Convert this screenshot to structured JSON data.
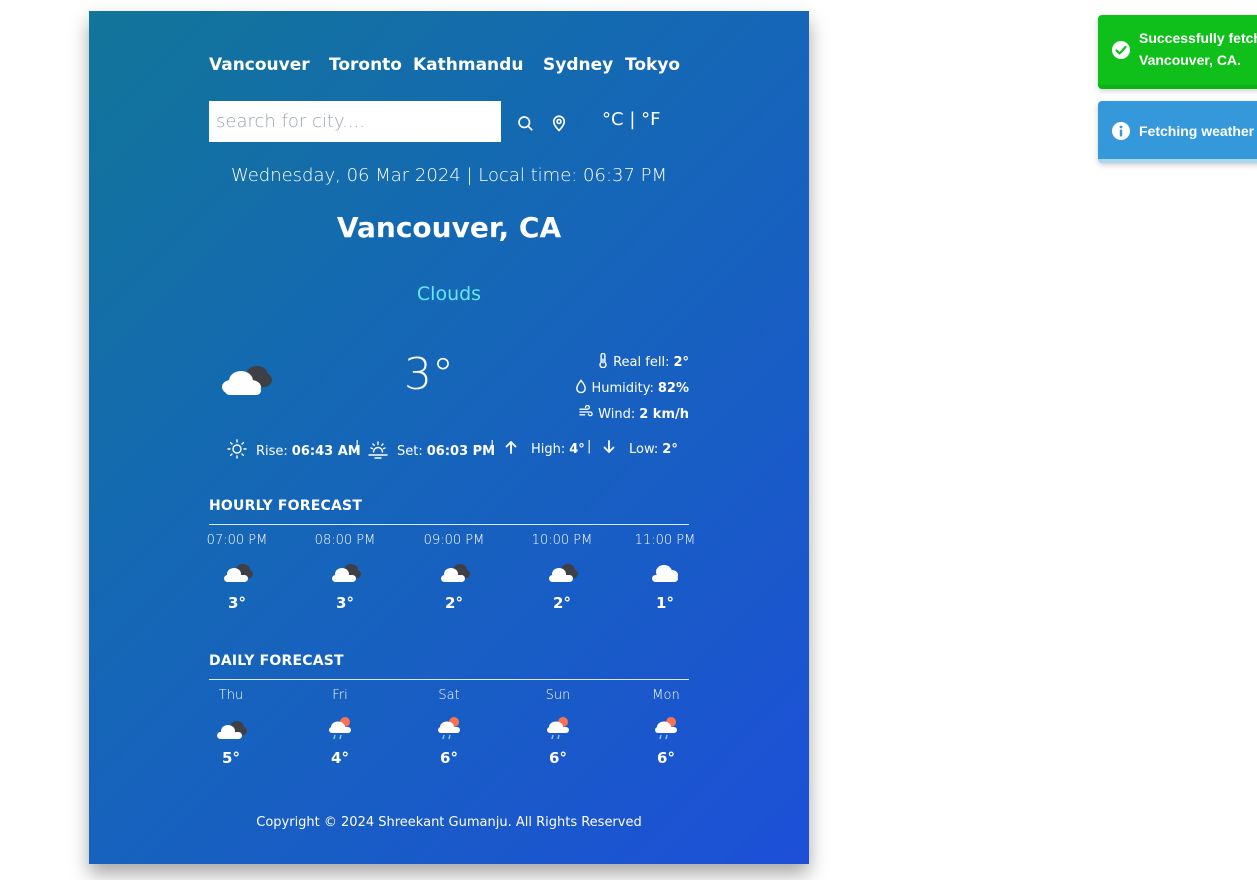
{
  "cities": [
    "Vancouver",
    "Toronto",
    "Kathmandu",
    "Sydney",
    "Tokyo"
  ],
  "search": {
    "placeholder": "search for city...."
  },
  "units": {
    "celsius": "°C",
    "separator": "|",
    "fahrenheit": "°F"
  },
  "datetime": "Wednesday, 06 Mar 2024 | Local time: 06:37 PM",
  "location": "Vancouver, CA",
  "condition": "Clouds",
  "current": {
    "temp": "3°",
    "icon": "cloudy-icon",
    "real_feel_label": "Real fell:",
    "real_feel": "2°",
    "humidity_label": "Humidity:",
    "humidity": "82%",
    "wind_label": "Wind:",
    "wind": "2 km/h"
  },
  "sun": {
    "rise_label": "Rise:",
    "rise": "06:43 AM",
    "set_label": "Set:",
    "set": "06:03 PM",
    "high_label": "High:",
    "high": "4°",
    "low_label": "Low:",
    "low": "2°",
    "sep": "|"
  },
  "hourly": {
    "title": "HOURLY FORECAST",
    "items": [
      {
        "label": "07:00 PM",
        "temp": "3°",
        "icon": "cloudy-icon"
      },
      {
        "label": "08:00 PM",
        "temp": "3°",
        "icon": "cloudy-icon"
      },
      {
        "label": "09:00 PM",
        "temp": "2°",
        "icon": "cloudy-icon"
      },
      {
        "label": "10:00 PM",
        "temp": "2°",
        "icon": "cloudy-icon"
      },
      {
        "label": "11:00 PM",
        "temp": "1°",
        "icon": "cloud-icon"
      }
    ]
  },
  "daily": {
    "title": "DAILY FORECAST",
    "items": [
      {
        "label": "Thu",
        "temp": "5°",
        "icon": "cloudy-icon"
      },
      {
        "label": "Fri",
        "temp": "4°",
        "icon": "rain-sun-icon"
      },
      {
        "label": "Sat",
        "temp": "6°",
        "icon": "rain-sun-icon"
      },
      {
        "label": "Sun",
        "temp": "6°",
        "icon": "rain-sun-icon"
      },
      {
        "label": "Mon",
        "temp": "6°",
        "icon": "rain-sun-icon"
      }
    ]
  },
  "copyright": "Copyright © 2024 Shreekant Gumanju. All Rights Reserved",
  "toasts": {
    "success_line1": "Successfully fetch",
    "success_line2": "Vancouver, CA.",
    "info": "Fetching weather"
  },
  "colors": {
    "accent": "#67e8f9",
    "success": "#0fbf1a",
    "info": "#3498db"
  }
}
